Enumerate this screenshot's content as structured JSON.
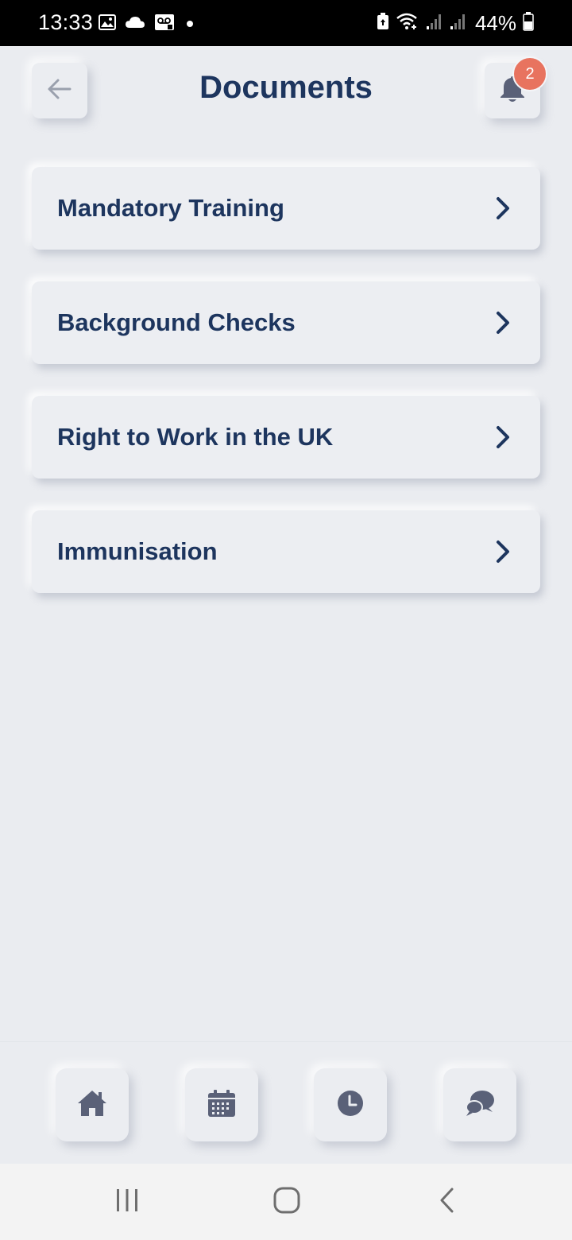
{
  "status_bar": {
    "time": "13:33",
    "battery_percent": "44%",
    "icons_left": [
      "image-icon",
      "cloud-icon",
      "voicemail-icon",
      "dot-icon"
    ],
    "icons_right": [
      "battery-saver-icon",
      "wifi-icon",
      "signal-icon",
      "signal-icon",
      "battery-icon"
    ]
  },
  "header": {
    "title": "Documents",
    "notification_count": "2"
  },
  "menu": {
    "items": [
      {
        "label": "Mandatory Training"
      },
      {
        "label": "Background Checks"
      },
      {
        "label": "Right to Work in the UK"
      },
      {
        "label": "Immunisation"
      }
    ]
  },
  "bottom_nav": {
    "items": [
      {
        "icon": "home-icon"
      },
      {
        "icon": "calendar-icon"
      },
      {
        "icon": "clock-icon"
      },
      {
        "icon": "chat-icon"
      }
    ]
  },
  "system_nav": {
    "items": [
      {
        "icon": "recent-apps-icon"
      },
      {
        "icon": "home-circle-icon"
      },
      {
        "icon": "back-chevron-icon"
      }
    ]
  },
  "colors": {
    "background": "#eaecf0",
    "primary_text": "#1d355e",
    "badge": "#e8735f",
    "icon_gray": "#5a6178"
  }
}
